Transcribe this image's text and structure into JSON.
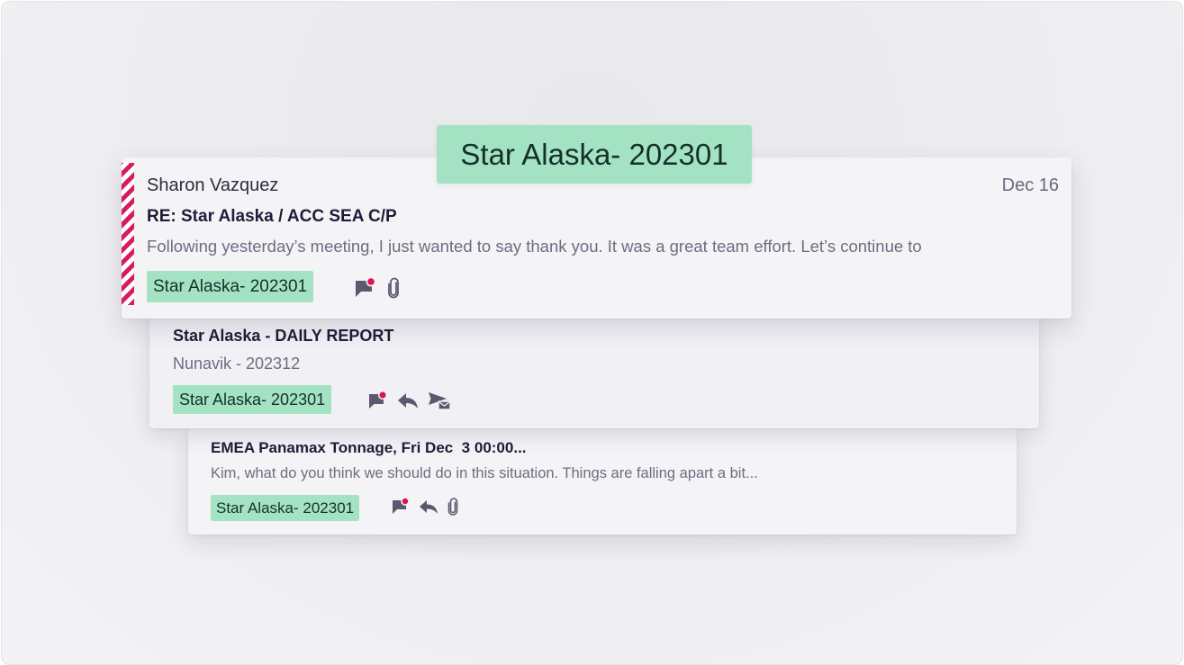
{
  "floating_tag": {
    "label": "Star Alaska- 202301"
  },
  "emails": [
    {
      "sender": "Sharon Vazquez",
      "date": "Dec 16",
      "subject": "RE: Star Alaska / ACC SEA C/P",
      "preview": "Following yesterday’s meeting, I just wanted to say thank you. It was a great team effort. Let’s continue to",
      "tag": "Star Alaska- 202301",
      "flagged_stripe": true,
      "icons": [
        "flag-notification-icon",
        "attachment-icon"
      ]
    },
    {
      "subject": "Star Alaska - DAILY REPORT",
      "preview": "Nunavik - 202312",
      "tag": "Star Alaska- 202301",
      "icons": [
        "flag-notification-icon",
        "reply-icon",
        "forward-icon"
      ]
    },
    {
      "subject": "EMEA Panamax Tonnage, Fri Dec  3 00:00...",
      "preview": "Kim, what do you think we should do in this situation. Things are falling apart a bit...",
      "tag": "Star Alaska- 202301",
      "icons": [
        "flag-notification-icon",
        "reply-icon",
        "attachment-icon"
      ]
    }
  ],
  "colors": {
    "tag_bg": "#a3e3c3",
    "stripe": "#d81b5d",
    "notification_dot": "#e0134f",
    "icon": "#5d5870"
  }
}
